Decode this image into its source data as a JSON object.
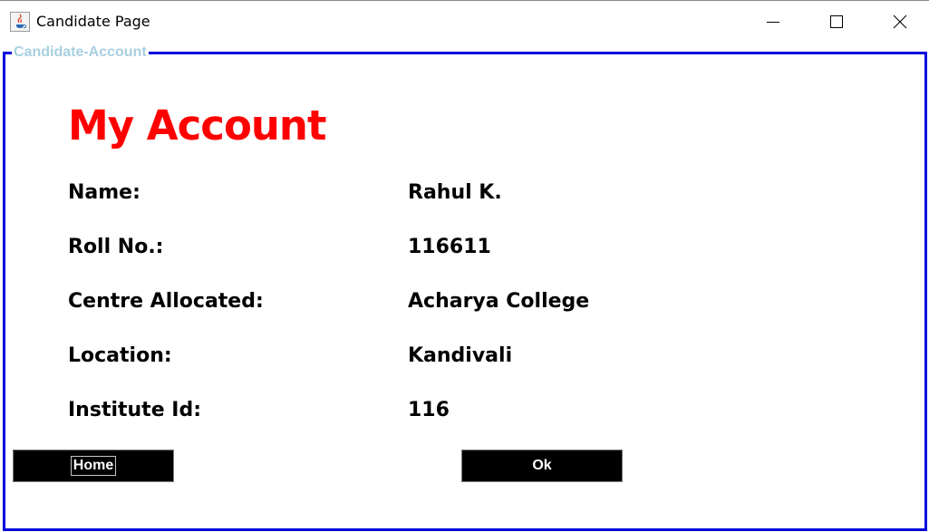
{
  "window": {
    "title": "Candidate Page",
    "icon": "java-cup-icon"
  },
  "panel": {
    "legend": "Candidate-Account",
    "border_color": "#0000dd"
  },
  "heading": {
    "text": "My Account",
    "color": "#ff0000"
  },
  "fields": [
    {
      "label": "Name:",
      "value": "Rahul K."
    },
    {
      "label": "Roll No.:",
      "value": "116611"
    },
    {
      "label": "Centre Allocated:",
      "value": "Acharya College"
    },
    {
      "label": "Location:",
      "value": "Kandivali"
    },
    {
      "label": "Institute Id:",
      "value": "116"
    }
  ],
  "buttons": {
    "home": "Home",
    "ok": "Ok"
  }
}
